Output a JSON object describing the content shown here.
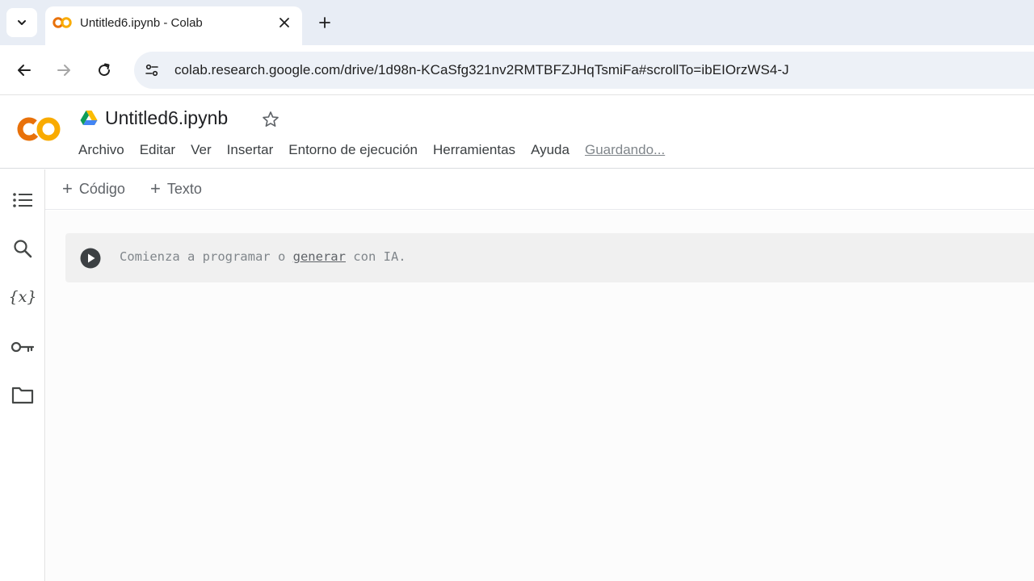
{
  "browser": {
    "tab": {
      "title": "Untitled6.ipynb - Colab",
      "favicon": "colab-logo-icon"
    },
    "url": "colab.research.google.com/drive/1d98n-KCaSfg321nv2RMTBFZJHqTsmiFa#scrollTo=ibEIOrzWS4-J"
  },
  "header": {
    "notebook_title": "Untitled6.ipynb",
    "menu": [
      "Archivo",
      "Editar",
      "Ver",
      "Insertar",
      "Entorno de ejecución",
      "Herramientas",
      "Ayuda"
    ],
    "status": "Guardando..."
  },
  "toolbar": {
    "add_code": "Código",
    "add_text": "Texto"
  },
  "cell": {
    "placeholder_before": "Comienza a programar o ",
    "placeholder_link": "generar",
    "placeholder_after": " con IA."
  },
  "left_rail": [
    "toc-icon",
    "search-icon",
    "variables-icon",
    "secrets-key-icon",
    "files-folder-icon"
  ],
  "colors": {
    "colab_orange": "#f9ab00",
    "colab_orange_dark": "#e8710a",
    "tabstrip_bg": "#e8edf5",
    "cell_bg": "#f0f0f0"
  }
}
